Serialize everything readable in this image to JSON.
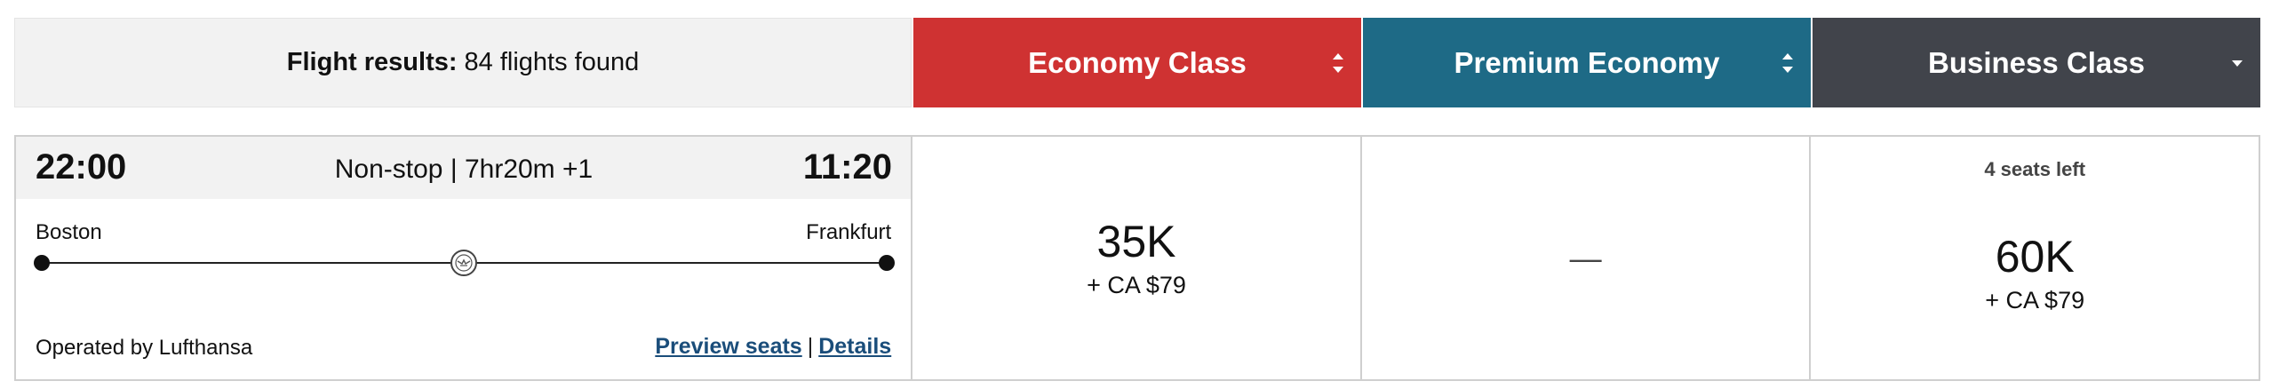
{
  "header": {
    "results_label": "Flight results:",
    "results_count": "84 flights found",
    "tabs": [
      {
        "label": "Economy Class",
        "color": "#cf3232",
        "icon": "sort-arrows-icon"
      },
      {
        "label": "Premium Economy",
        "color": "#1e6a86",
        "icon": "sort-arrows-icon"
      },
      {
        "label": "Business Class",
        "color": "#41444b",
        "icon": "sort-down-icon"
      }
    ]
  },
  "flight": {
    "departure_time": "22:00",
    "arrival_time": "11:20",
    "duration": "Non-stop | 7hr20m +1",
    "origin": "Boston",
    "destination": "Frankfurt",
    "operated_by": "Operated by Lufthansa",
    "preview_seats": "Preview seats",
    "separator": "|",
    "details": "Details",
    "fares": {
      "economy": {
        "points": "35K",
        "taxes": "+ CA $79"
      },
      "premium": {
        "unavailable": "—"
      },
      "business": {
        "seats_left": "4 seats left",
        "points": "60K",
        "taxes": "+ CA $79"
      }
    }
  },
  "colors": {
    "link": "#1a4d7a",
    "header_bg": "#f2f2f2"
  }
}
